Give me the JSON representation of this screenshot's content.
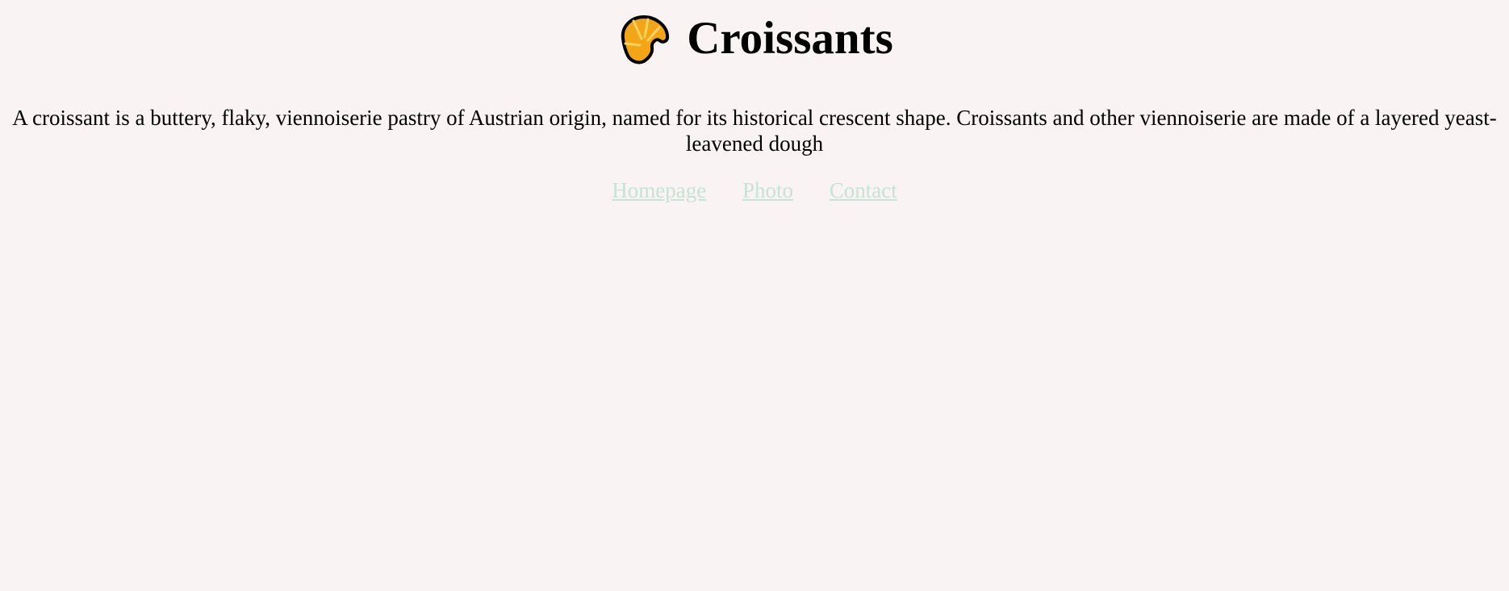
{
  "header": {
    "logo_icon": "croissant-icon",
    "title": "Croissants"
  },
  "main": {
    "description": "A croissant is a buttery, flaky, viennoiserie pastry of Austrian origin, named for its historical crescent shape. Croissants and other viennoiserie are made of a layered yeast-leavened dough"
  },
  "nav": {
    "links": [
      {
        "label": "Homepage"
      },
      {
        "label": "Photo"
      },
      {
        "label": "Contact"
      }
    ]
  },
  "colors": {
    "background": "#f9f3f3",
    "link": "#c4e4d4",
    "croissant": "#f2a516"
  }
}
